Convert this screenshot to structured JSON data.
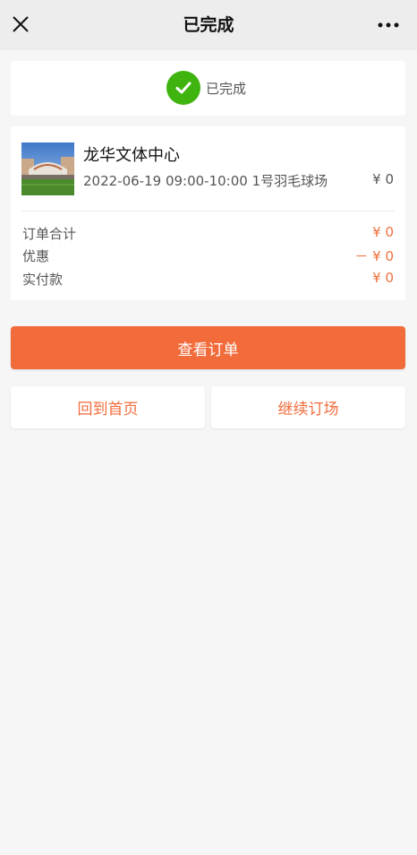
{
  "nav": {
    "title": "已完成",
    "close_icon": "close-icon",
    "more_icon": "more-dots-icon"
  },
  "status": {
    "icon": "check-circle-icon",
    "text": "已完成",
    "color": "#3fb40e"
  },
  "order": {
    "venue_name": "龙华文体中心",
    "booking": "2022-06-19 09:00-10:00 1号羽毛球场",
    "booking_price": "¥ 0",
    "rows": [
      {
        "label": "订单合计",
        "value": "¥ 0"
      },
      {
        "label": "优惠",
        "value": "－ ¥ 0"
      },
      {
        "label": "实付款",
        "value": "¥ 0"
      }
    ]
  },
  "actions": {
    "view_order": "查看订单",
    "home": "回到首页",
    "continue_booking": "继续订场"
  },
  "colors": {
    "accent": "#f26b3b",
    "success": "#3fb40e"
  }
}
